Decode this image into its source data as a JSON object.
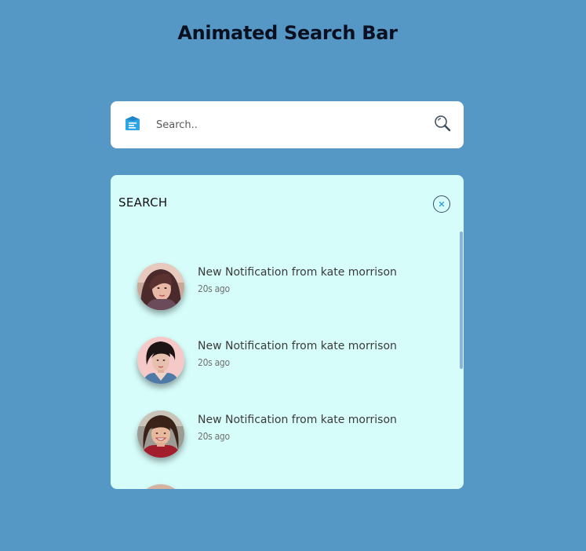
{
  "header": {
    "title": "Animated Search Bar"
  },
  "search": {
    "placeholder": "Search..",
    "value": "",
    "menu_icon": "menu-app-icon",
    "submit_icon": "search-icon"
  },
  "panel": {
    "title": "SEARCH",
    "close_icon": "close-icon",
    "notifications": [
      {
        "title": "New Notification from kate morrison",
        "time": "20s ago",
        "avatar": "avatar-woman-1"
      },
      {
        "title": "New Notification from kate morrison",
        "time": "20s ago",
        "avatar": "avatar-woman-2"
      },
      {
        "title": "New Notification from kate morrison",
        "time": "20s ago",
        "avatar": "avatar-woman-3"
      },
      {
        "title": "",
        "time": "",
        "avatar": "avatar-woman-4"
      }
    ]
  },
  "colors": {
    "background": "#5597c5",
    "panel": "#d6fdfa",
    "search_bar": "#ffffff",
    "accent": "#2d9cdb"
  }
}
